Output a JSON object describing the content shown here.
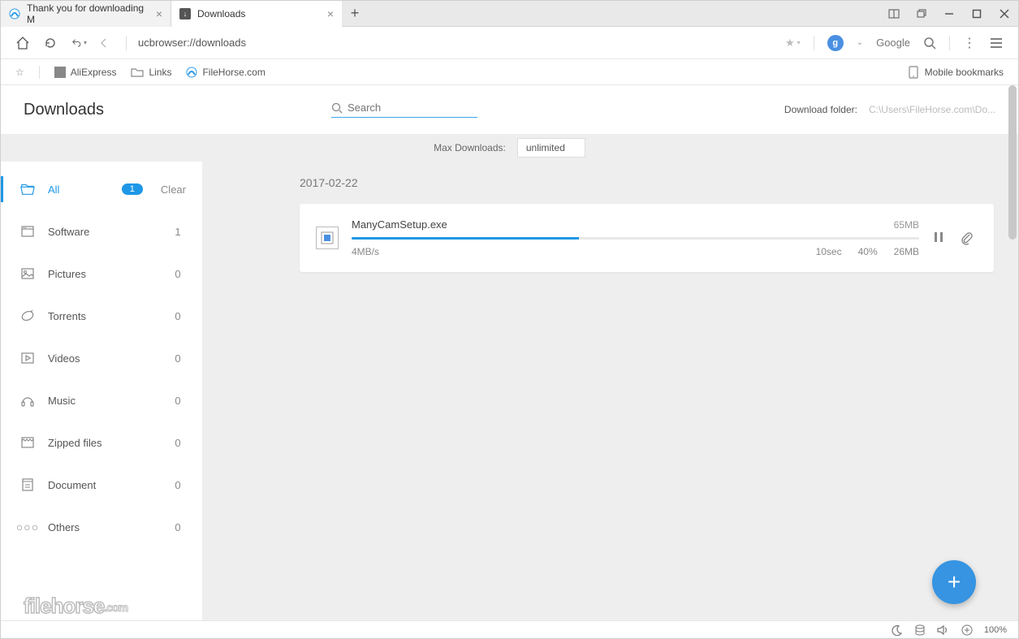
{
  "tabs": [
    {
      "title": "Thank you for downloading M",
      "active": false
    },
    {
      "title": "Downloads",
      "active": true
    }
  ],
  "url": "ucbrowser://downloads",
  "search_engine_label": "Google",
  "bookmarks_bar": {
    "items": [
      "AliExpress",
      "Links",
      "FileHorse.com"
    ],
    "mobile_label": "Mobile bookmarks"
  },
  "page": {
    "title": "Downloads",
    "search_placeholder": "Search",
    "folder_label": "Download folder:",
    "folder_path": "C:\\Users\\FileHorse.com\\Do...",
    "max_label": "Max Downloads:",
    "max_value": "unlimited"
  },
  "sidebar": {
    "clear_label": "Clear",
    "items": [
      {
        "label": "All",
        "count": "1",
        "active": true
      },
      {
        "label": "Software",
        "count": "1"
      },
      {
        "label": "Pictures",
        "count": "0"
      },
      {
        "label": "Torrents",
        "count": "0"
      },
      {
        "label": "Videos",
        "count": "0"
      },
      {
        "label": "Music",
        "count": "0"
      },
      {
        "label": "Zipped files",
        "count": "0"
      },
      {
        "label": "Document",
        "count": "0"
      },
      {
        "label": "Others",
        "count": "0"
      }
    ]
  },
  "downloads": {
    "date": "2017-02-22",
    "item": {
      "name": "ManyCamSetup.exe",
      "total_size": "65MB",
      "speed": "4MB/s",
      "eta": "10sec",
      "percent": "40%",
      "downloaded": "26MB",
      "progress_pct": 40
    }
  },
  "status": {
    "zoom": "100%"
  },
  "watermark": "filehorse",
  "watermark_suffix": ".com"
}
